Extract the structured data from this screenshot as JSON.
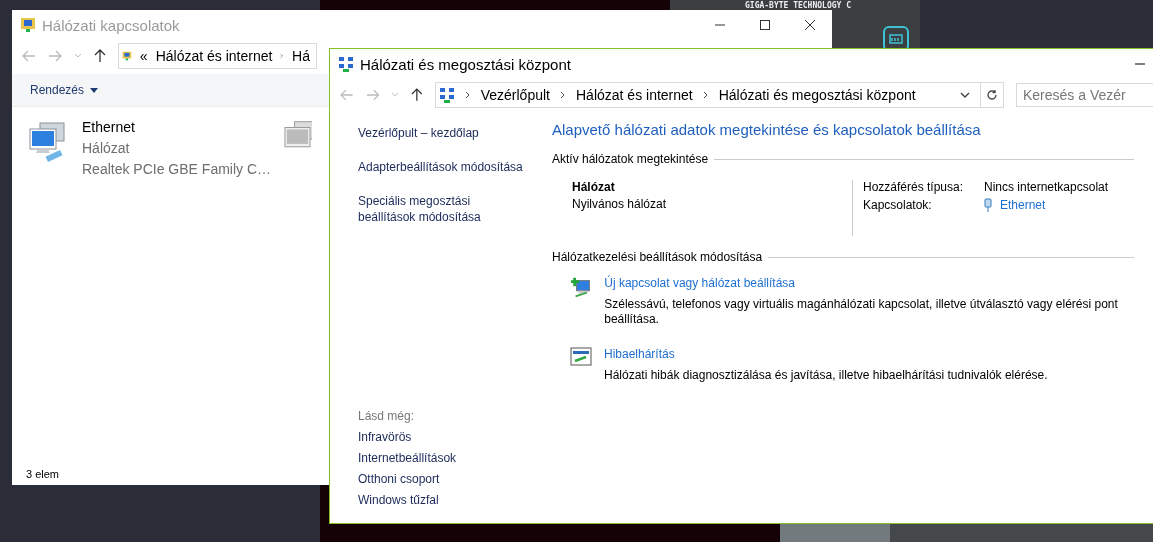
{
  "desktop": {
    "background_text": "GIGA-BYTE TECHNOLOGY C"
  },
  "back_window": {
    "title": "Hálózati kapcsolatok",
    "overflow_mark": "«",
    "breadcrumb": [
      "Hálózat és internet",
      "Há"
    ],
    "organize": "Rendezés",
    "items": [
      {
        "name": "Ethernet",
        "network": "Hálózat",
        "adapter": "Realtek PCIe GBE Family C…"
      }
    ],
    "status": "3 elem"
  },
  "front_window": {
    "title": "Hálózati és megosztási központ",
    "breadcrumb": [
      "Vezérlőpult",
      "Hálózat és internet",
      "Hálózati és megosztási központ"
    ],
    "search": {
      "placeholder": "Keresés a Vezér"
    },
    "sidebar": {
      "links": [
        "Vezérlőpult – kezdőlap",
        "Adapterbeállítások módosítása",
        "Speciális megosztási beállítások módosítása"
      ],
      "see_also_heading": "Lásd még:",
      "see_also": [
        "Infravörös",
        "Internetbeállítások",
        "Otthoni csoport",
        "Windows tűzfal"
      ]
    },
    "heading": "Alapvető hálózati adatok megtekintése és kapcsolatok beállítása",
    "active_networks": {
      "title": "Aktív hálózatok megtekintése",
      "network_name": "Hálózat",
      "network_type": "Nyilvános hálózat",
      "access_label": "Hozzáférés típusa:",
      "access_value": "Nincs internetkapcsolat",
      "connections_label": "Kapcsolatok:",
      "connections_value": "Ethernet"
    },
    "settings": {
      "title": "Hálózatkezelési beállítások módosítása",
      "tasks": [
        {
          "kind": "new-connection",
          "title": "Új kapcsolat vagy hálózat beállítása",
          "description": "Szélessávú, telefonos vagy virtuális magánhálózati kapcsolat, illetve útválasztó vagy elérési pont beállítása."
        },
        {
          "kind": "troubleshoot",
          "title": "Hibaelhárítás",
          "description": "Hálózati hibák diagnosztizálása és javítása, illetve hibaelhárítási tudnivalók elérése."
        }
      ]
    }
  }
}
